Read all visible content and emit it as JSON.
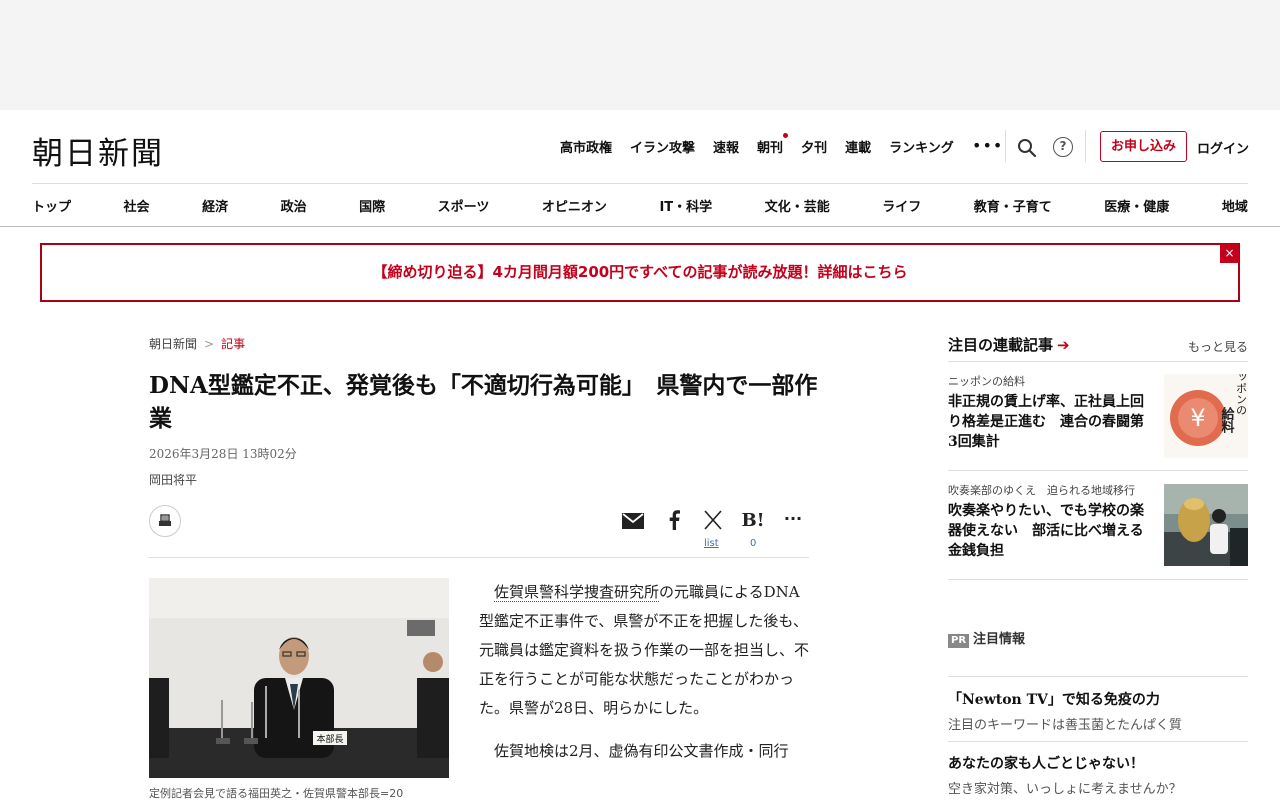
{
  "header": {
    "logo": "朝日新聞",
    "top_links": [
      {
        "label": "高市政権",
        "dot": false
      },
      {
        "label": "イラン攻撃",
        "dot": false
      },
      {
        "label": "速報",
        "dot": false
      },
      {
        "label": "朝刊",
        "dot": true
      },
      {
        "label": "夕刊",
        "dot": false
      },
      {
        "label": "連載",
        "dot": false
      },
      {
        "label": "ランキング",
        "dot": false
      }
    ],
    "more": "•••",
    "help": "?",
    "subscribe": "お申し込み",
    "login": "ログイン",
    "categories": [
      "トップ",
      "社会",
      "経済",
      "政治",
      "国際",
      "スポーツ",
      "オピニオン",
      "IT・科学",
      "文化・芸能",
      "ライフ",
      "教育・子育て",
      "医療・健康",
      "地域"
    ]
  },
  "promo": {
    "text": "【締め切り迫る】4カ月間月額200円ですべての記事が読み放題！詳細はこちら",
    "close": "×"
  },
  "article": {
    "breadcrumb": [
      "朝日新聞",
      "記事"
    ],
    "breadcrumb_sep": ">",
    "headline": "DNA型鑑定不正、発覚後も「不適切行為可能」　県警内で一部作業",
    "timestamp": "2026年3月28日 13時02分",
    "author": "岡田将平",
    "share": {
      "x_label": "list",
      "hatena_count": "0",
      "hatena": "B!",
      "more": "···"
    },
    "photo": {
      "nameplate": "本部長"
    },
    "caption": "定例記者会見で語る福田英之・佐賀県警本部長=20",
    "paragraphs": [
      {
        "link": "佐賀県警科学捜査研究所",
        "text": "の元職員によるDNA型鑑定不正事件で、県警が不正を把握した後も、元職員は鑑定資料を扱う作業の一部を担当し、不正を行うことが可能な状態だったことがわかった。県警が28日、明らかにした。"
      },
      {
        "link": "",
        "text": "佐賀地検は2月、虚偽有印公文書作成・同行"
      }
    ]
  },
  "sidebar": {
    "title": "注目の連載記事",
    "arrow": "➔",
    "more": "もっと見る",
    "items": [
      {
        "kicker": "ニッポンの給料",
        "title": "非正規の賃上げ率、正社員上回り格差是正進む　連合の春闘第3回集計",
        "thumb_text_1": "ニッポンの",
        "thumb_text_2": "給料"
      },
      {
        "kicker": "吹奏楽部のゆくえ　迫られる地域移行",
        "title": "吹奏楽やりたい、でも学校の楽器使えない　部活に比べ増える金銭負担"
      }
    ],
    "pr_badge": "PR",
    "pr_label": "注目情報",
    "pr_items": [
      {
        "title": "「Newton TV」で知る免疫の力",
        "sub": "注目のキーワードは善玉菌とたんぱく質"
      },
      {
        "title": "あなたの家も人ごとじゃない！",
        "sub": "空き家対策、いっしょに考えませんか？"
      }
    ]
  },
  "colors": {
    "accent": "#c4001a",
    "link_blue": "#3b6fc4"
  }
}
